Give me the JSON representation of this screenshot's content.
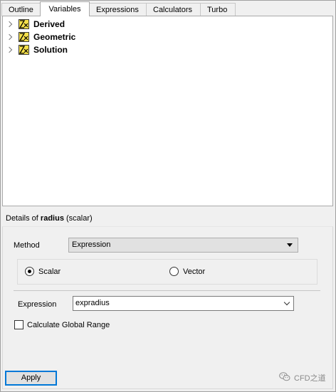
{
  "tabs": [
    {
      "label": "Outline"
    },
    {
      "label": "Variables"
    },
    {
      "label": "Expressions"
    },
    {
      "label": "Calculators"
    },
    {
      "label": "Turbo"
    }
  ],
  "active_tab": "Variables",
  "tree": {
    "items": [
      {
        "label": "Derived",
        "icon": "variable-folder-icon"
      },
      {
        "label": "Geometric",
        "icon": "variable-folder-icon"
      },
      {
        "label": "Solution",
        "icon": "variable-folder-icon"
      }
    ]
  },
  "details": {
    "prefix": "Details of ",
    "variable_name": "radius",
    "variable_type": " (scalar)"
  },
  "form": {
    "method_label": "Method",
    "method_value": "Expression",
    "radio_scalar": "Scalar",
    "radio_vector": "Vector",
    "selected_radio": "Scalar",
    "expression_label": "Expression",
    "expression_value": "expradius",
    "global_range_label": "Calculate Global Range",
    "global_range_checked": false,
    "apply_label": "Apply"
  },
  "watermark": {
    "text": "CFD之道",
    "icon": "wechat-icon"
  },
  "colors": {
    "accent": "#0078d7",
    "icon_yellow": "#f5e04a"
  }
}
